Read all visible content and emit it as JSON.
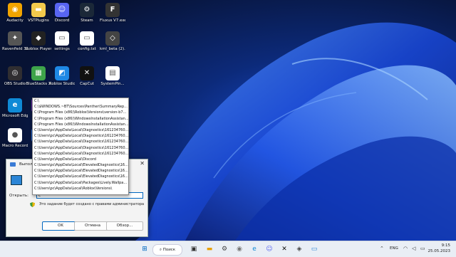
{
  "desktop": {
    "icons": [
      {
        "label": "Audacity",
        "icon": "audacity-icon",
        "color": "#f2a400",
        "glyph": "◉"
      },
      {
        "label": "VSTPlugins",
        "icon": "folder-icon",
        "color": "#f2c94c",
        "glyph": "▬"
      },
      {
        "label": "Discord",
        "icon": "discord-icon",
        "color": "#5865f2",
        "glyph": "☺"
      },
      {
        "label": "Steam",
        "icon": "steam-icon",
        "color": "#1b2838",
        "glyph": "⚙"
      },
      {
        "label": "Fluxus V7.exe",
        "icon": "fluxus-icon",
        "color": "#333333",
        "glyph": "F"
      },
      {
        "label": "Ravenfield 32bit",
        "icon": "ravenfield-icon",
        "color": "#555555",
        "glyph": "✦"
      },
      {
        "label": "Roblox Player",
        "icon": "roblox-icon",
        "color": "#222222",
        "glyph": "◆"
      },
      {
        "label": "settings",
        "icon": "file-icon",
        "color": "#ffffff",
        "glyph": "▭"
      },
      {
        "label": "config.txt",
        "icon": "text-file-icon",
        "color": "#ffffff",
        "glyph": "▭"
      },
      {
        "label": "kml_beta (2).exe",
        "icon": "exe-icon",
        "color": "#444444",
        "glyph": "◇"
      },
      {
        "label": "OBS Studio",
        "icon": "obs-icon",
        "color": "#302e31",
        "glyph": "◎"
      },
      {
        "label": "BlueStacks X",
        "icon": "bluestacks-icon",
        "color": "#3ea44a",
        "glyph": "▦"
      },
      {
        "label": "Roblox Studio",
        "icon": "roblox-studio-icon",
        "color": "#1e88e5",
        "glyph": "◩"
      },
      {
        "label": "CapCut",
        "icon": "capcut-icon",
        "color": "#111111",
        "glyph": "✕"
      },
      {
        "label": "SystemPin...",
        "icon": "system-file-icon",
        "color": "#ffffff",
        "glyph": "▤"
      },
      {
        "label": "Microsoft Edge",
        "icon": "edge-icon",
        "color": "#0f8ad6",
        "glyph": "e"
      },
      {
        "label": "Au...",
        "icon": "app-icon",
        "color": "#6b2fa4",
        "glyph": "A"
      },
      {
        "label": "Macro Recorder",
        "icon": "macro-recorder-icon",
        "color": "#ffffff",
        "glyph": "●"
      },
      {
        "label": "Bl...",
        "icon": "app-icon",
        "color": "#2a6bd1",
        "glyph": "B"
      }
    ]
  },
  "run_dialog": {
    "title": "Выполн...",
    "open_label": "Открыть:",
    "open_value": "c",
    "note": "Это задание будет создано с правами администратора",
    "ok": "OK",
    "cancel": "Отмена",
    "browse": "Обзор...",
    "close_glyph": "✕"
  },
  "dropdown": {
    "items": [
      "C:\\",
      "C:\\$WINDOWS.~BT\\Sources\\Panther\\SummaryRep...",
      "C:\\Program Files (x86)\\Roblox\\Versions\\version-b7...",
      "C:\\Program Files (x86)\\WindowsInstallationAssistan...",
      "C:\\Program Files (x86)\\WindowsInstallationAssistan...",
      "C:\\Users\\pc\\AppData\\Local\\Diagnostics\\161234760...",
      "C:\\Users\\pc\\AppData\\Local\\Diagnostics\\161234760...",
      "C:\\Users\\pc\\AppData\\Local\\Diagnostics\\161234760...",
      "C:\\Users\\pc\\AppData\\Local\\Diagnostics\\161234760...",
      "C:\\Users\\pc\\AppData\\Local\\Diagnostics\\161234760...",
      "C:\\Users\\pc\\AppData\\Local\\Discord",
      "C:\\Users\\pc\\AppData\\Local\\ElevatedDiagnostics\\16...",
      "C:\\Users\\pc\\AppData\\Local\\ElevatedDiagnostics\\16...",
      "C:\\Users\\pc\\AppData\\Local\\ElevatedDiagnostics\\16...",
      "C:\\Users\\pc\\AppData\\Local\\Packages\\Lively.Wallpa...",
      "C:\\Users\\pc\\AppData\\Local\\Roblox\\Versions\\"
    ]
  },
  "taskbar": {
    "search_label": "Поиск",
    "lang": "ENG",
    "time": "9:15",
    "date": "25.05.2023",
    "accent": "#0067c0"
  }
}
